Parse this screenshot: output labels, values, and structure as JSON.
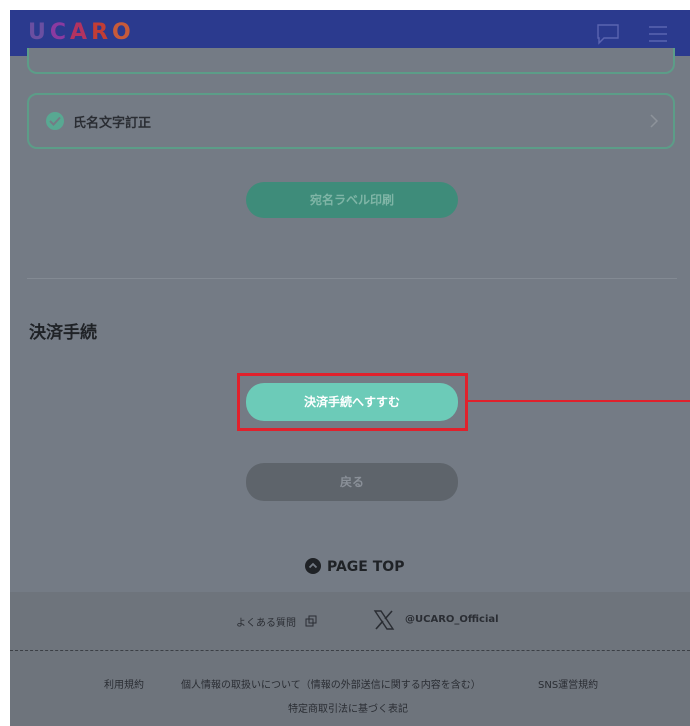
{
  "header": {
    "logo": "UCARO",
    "logo_letters": [
      "U",
      "C",
      "A",
      "R",
      "O"
    ],
    "icons": [
      "chat-icon",
      "menu-icon"
    ]
  },
  "main": {
    "card_label": "氏名文字訂正",
    "label_print_button": "宛名ラベル印刷",
    "section_title": "決済手続",
    "pay_button": "決済手続へすすむ",
    "back_button": "戻る",
    "page_top": "PAGE TOP"
  },
  "footer": {
    "faq": "よくある質問",
    "x_handle": "@UCARO_Official",
    "terms": "利用規約",
    "privacy": "個人情報の取扱いについて（情報の外部送信に関する内容を含む）",
    "sns_terms": "SNS運営規約",
    "commerce_law": "特定商取引法に基づく表記"
  },
  "colors": {
    "header_bg": "#2b3a8e",
    "overlay_bg": "#747b85",
    "accent": "#6ccbb8",
    "highlight": "#e0212c"
  }
}
